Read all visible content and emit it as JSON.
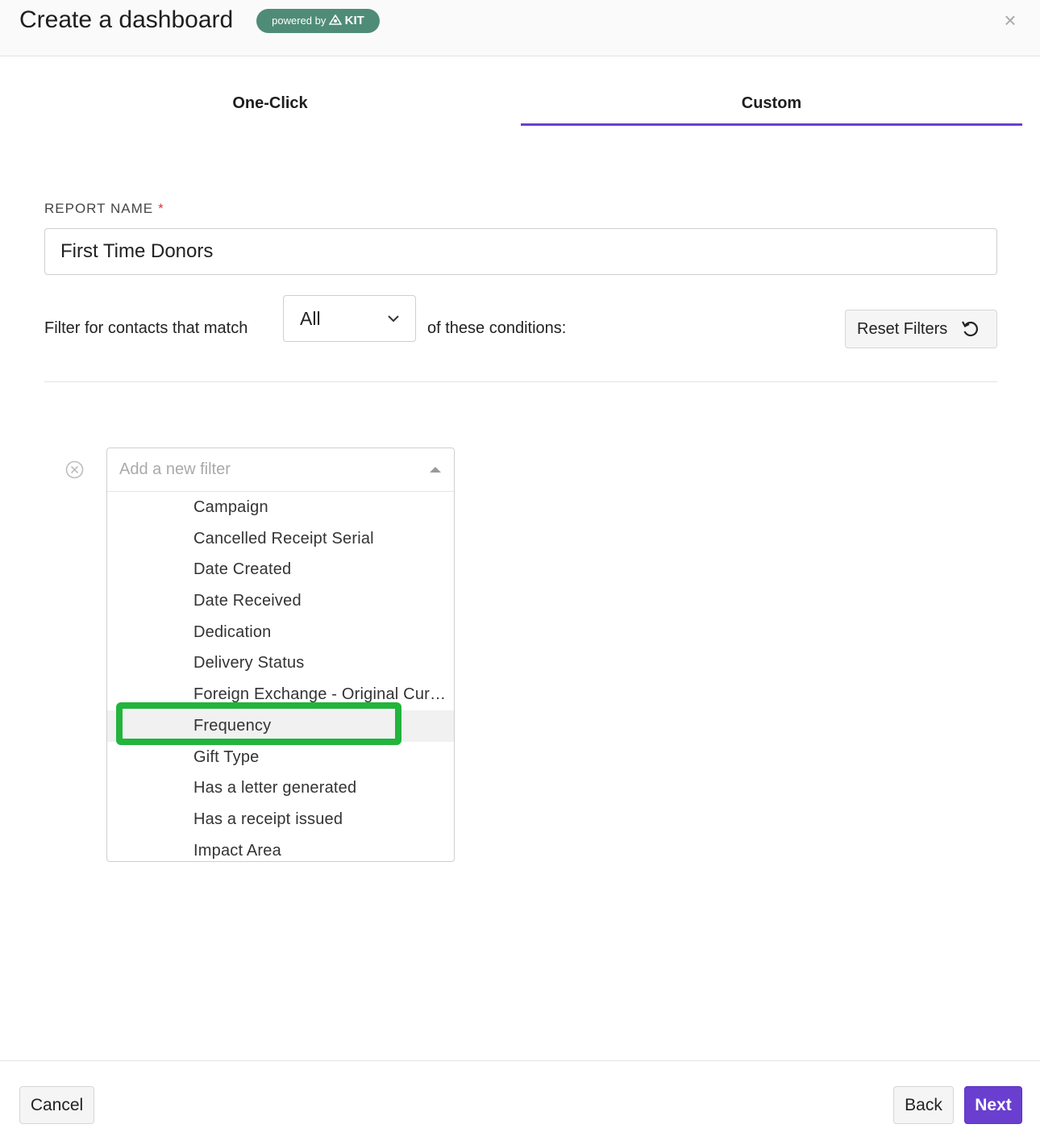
{
  "header": {
    "title": "Create a dashboard",
    "badge_prefix": "powered by",
    "badge_brand": "KIT",
    "close_glyph": "×"
  },
  "tabs": [
    {
      "label": "One-Click",
      "active": false
    },
    {
      "label": "Custom",
      "active": true
    }
  ],
  "report": {
    "label": "REPORT NAME",
    "required_marker": "*",
    "value": "First Time Donors"
  },
  "filter": {
    "prefix": "Filter for contacts that match",
    "match_value": "All",
    "suffix": "of these conditions:",
    "reset_label": "Reset Filters"
  },
  "dropdown": {
    "placeholder": "Add a new filter",
    "items": [
      "Campaign",
      "Cancelled Receipt Serial",
      "Date Created",
      "Date Received",
      "Dedication",
      "Delivery Status",
      "Foreign Exchange - Original Currency",
      "Frequency",
      "Gift Type",
      "Has a letter generated",
      "Has a receipt issued",
      "Impact Area"
    ],
    "highlighted": "Frequency"
  },
  "footer": {
    "cancel": "Cancel",
    "back": "Back",
    "next": "Next"
  },
  "colors": {
    "accent": "#6a3fd0",
    "badge": "#4f8c78",
    "annotation": "#22b43c"
  }
}
